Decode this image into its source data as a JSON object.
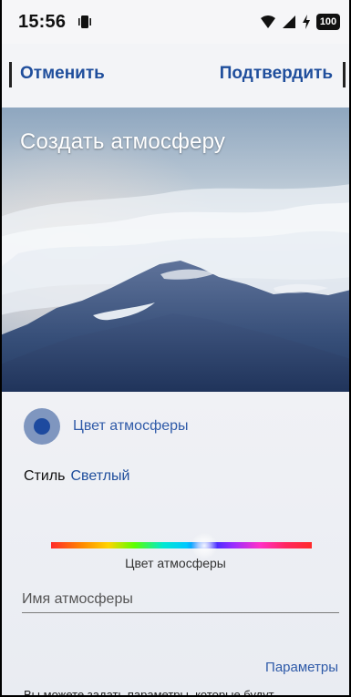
{
  "status_bar": {
    "time": "15:56",
    "battery_text": "100",
    "vibrate_icon": "vibrate-icon",
    "wifi_icon": "wifi-icon",
    "signal_icon": "signal-icon",
    "charging_icon": "charging-icon"
  },
  "header": {
    "cancel_label": "Отменить",
    "confirm_label": "Подтвердить",
    "title": "Создать атмосферу"
  },
  "form": {
    "color_label": "Цвет атмосферы",
    "style_label": "Стиль",
    "style_value": "Светлый",
    "spectrum_label": "Цвет атмосферы",
    "name_placeholder": "Имя атмосферы",
    "parameters_label": "Параметры",
    "footer_text": "Вы можете задать параметры, которые будут"
  },
  "colors": {
    "accent": "#1F4E9C",
    "selected_color": "#1D4A9F",
    "screen_background": "#F0F1F5"
  }
}
